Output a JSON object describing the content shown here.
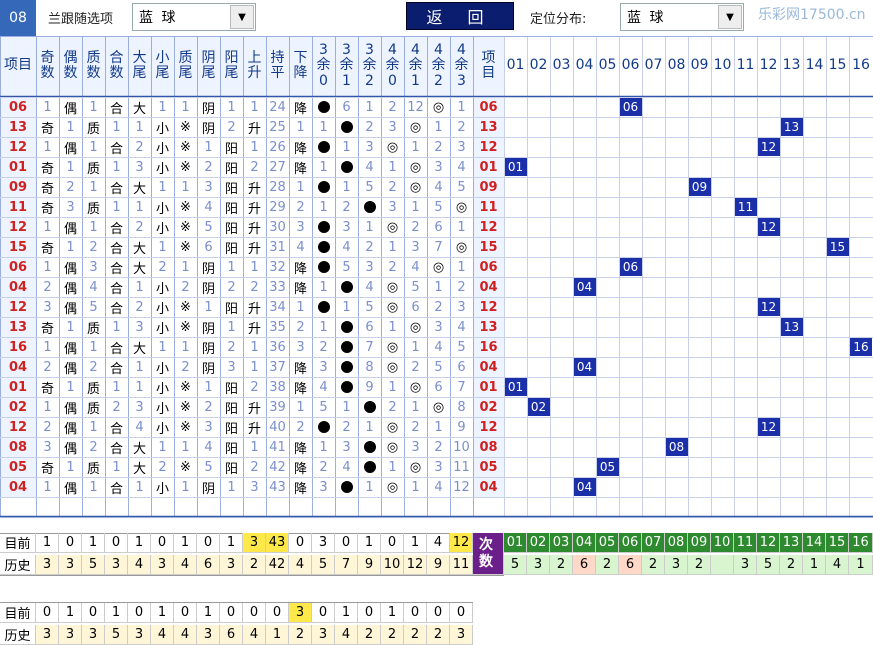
{
  "topbar": {
    "num": "08",
    "sel_label": "兰跟随选项",
    "combo1": "蓝 球",
    "back": "返 回",
    "dist_label": "定位分布:",
    "combo2": "蓝 球",
    "watermark": "乐彩网17500.cn"
  },
  "headers": [
    "项目",
    "奇数",
    "偶数",
    "质数",
    "合数",
    "大尾",
    "小尾",
    "质尾",
    "阴尾",
    "阳尾",
    "上升",
    "持平",
    "下降",
    "3余0",
    "3余1",
    "3余2",
    "4余0",
    "4余1",
    "4余2",
    "4余3",
    "项目"
  ],
  "cols": [
    "01",
    "02",
    "03",
    "04",
    "05",
    "06",
    "07",
    "08",
    "09",
    "10",
    "11",
    "12",
    "13",
    "14",
    "15",
    "16"
  ],
  "rows": [
    [
      "06",
      "1",
      "偶",
      "1",
      "合",
      "大",
      "1",
      "1",
      "阴",
      "1",
      "1",
      "24",
      "降",
      "●",
      "6",
      "1",
      "2",
      "12",
      "◎",
      "1",
      "06"
    ],
    [
      "13",
      "奇",
      "1",
      "质",
      "1",
      "1",
      "小",
      "※",
      "阴",
      "2",
      "升",
      "25",
      "1",
      "1",
      "●",
      "2",
      "3",
      "◎",
      "1",
      "2",
      "13"
    ],
    [
      "12",
      "1",
      "偶",
      "1",
      "合",
      "2",
      "小",
      "※",
      "1",
      "阳",
      "1",
      "26",
      "降",
      "●",
      "1",
      "3",
      "◎",
      "1",
      "2",
      "3",
      "12"
    ],
    [
      "01",
      "奇",
      "1",
      "质",
      "1",
      "3",
      "小",
      "※",
      "2",
      "阳",
      "2",
      "27",
      "降",
      "1",
      "●",
      "4",
      "1",
      "◎",
      "3",
      "4",
      "01"
    ],
    [
      "09",
      "奇",
      "2",
      "1",
      "合",
      "大",
      "1",
      "1",
      "3",
      "阳",
      "升",
      "28",
      "1",
      "●",
      "1",
      "5",
      "2",
      "◎",
      "4",
      "5",
      "09"
    ],
    [
      "11",
      "奇",
      "3",
      "质",
      "1",
      "1",
      "小",
      "※",
      "4",
      "阳",
      "升",
      "29",
      "2",
      "1",
      "2",
      "●",
      "3",
      "1",
      "5",
      "◎",
      "11"
    ],
    [
      "12",
      "1",
      "偶",
      "1",
      "合",
      "2",
      "小",
      "※",
      "5",
      "阳",
      "升",
      "30",
      "3",
      "●",
      "3",
      "1",
      "◎",
      "2",
      "6",
      "1",
      "12"
    ],
    [
      "15",
      "奇",
      "1",
      "2",
      "合",
      "大",
      "1",
      "※",
      "6",
      "阳",
      "升",
      "31",
      "4",
      "●",
      "4",
      "2",
      "1",
      "3",
      "7",
      "◎",
      "15"
    ],
    [
      "06",
      "1",
      "偶",
      "3",
      "合",
      "大",
      "2",
      "1",
      "阴",
      "1",
      "1",
      "32",
      "降",
      "●",
      "5",
      "3",
      "2",
      "4",
      "◎",
      "1",
      "06"
    ],
    [
      "04",
      "2",
      "偶",
      "4",
      "合",
      "1",
      "小",
      "2",
      "阴",
      "2",
      "2",
      "33",
      "降",
      "1",
      "●",
      "4",
      "◎",
      "5",
      "1",
      "2",
      "04"
    ],
    [
      "12",
      "3",
      "偶",
      "5",
      "合",
      "2",
      "小",
      "※",
      "1",
      "阳",
      "升",
      "34",
      "1",
      "●",
      "1",
      "5",
      "◎",
      "6",
      "2",
      "3",
      "12"
    ],
    [
      "13",
      "奇",
      "1",
      "质",
      "1",
      "3",
      "小",
      "※",
      "阴",
      "1",
      "升",
      "35",
      "2",
      "1",
      "●",
      "6",
      "1",
      "◎",
      "3",
      "4",
      "13"
    ],
    [
      "16",
      "1",
      "偶",
      "1",
      "合",
      "大",
      "1",
      "1",
      "阴",
      "2",
      "1",
      "36",
      "3",
      "2",
      "●",
      "7",
      "◎",
      "1",
      "4",
      "5",
      "16"
    ],
    [
      "04",
      "2",
      "偶",
      "2",
      "合",
      "1",
      "小",
      "2",
      "阴",
      "3",
      "1",
      "37",
      "降",
      "3",
      "●",
      "8",
      "◎",
      "2",
      "5",
      "6",
      "04"
    ],
    [
      "01",
      "奇",
      "1",
      "质",
      "1",
      "1",
      "小",
      "※",
      "1",
      "阳",
      "2",
      "38",
      "降",
      "4",
      "●",
      "9",
      "1",
      "◎",
      "6",
      "7",
      "01"
    ],
    [
      "02",
      "1",
      "偶",
      "质",
      "2",
      "3",
      "小",
      "※",
      "2",
      "阳",
      "升",
      "39",
      "1",
      "5",
      "1",
      "●",
      "2",
      "1",
      "◎",
      "8",
      "02"
    ],
    [
      "12",
      "2",
      "偶",
      "1",
      "合",
      "4",
      "小",
      "※",
      "3",
      "阳",
      "升",
      "40",
      "2",
      "●",
      "2",
      "1",
      "◎",
      "2",
      "1",
      "9",
      "12"
    ],
    [
      "08",
      "3",
      "偶",
      "2",
      "合",
      "大",
      "1",
      "1",
      "4",
      "阳",
      "1",
      "41",
      "降",
      "1",
      "3",
      "●",
      "◎",
      "3",
      "2",
      "10",
      "08"
    ],
    [
      "05",
      "奇",
      "1",
      "质",
      "1",
      "大",
      "2",
      "※",
      "5",
      "阳",
      "2",
      "42",
      "降",
      "2",
      "4",
      "●",
      "1",
      "◎",
      "3",
      "11",
      "05"
    ],
    [
      "04",
      "1",
      "偶",
      "1",
      "合",
      "1",
      "小",
      "1",
      "阴",
      "1",
      "3",
      "43",
      "降",
      "3",
      "●",
      "1",
      "◎",
      "1",
      "4",
      "12",
      "04"
    ]
  ],
  "stats": {
    "now_label": "目前",
    "hist_label": "历史",
    "count_label": "次数",
    "now": [
      "1",
      "0",
      "1",
      "0",
      "1",
      "0",
      "1",
      "0",
      "1",
      "3",
      "43",
      "0",
      "3",
      "0",
      "1",
      "0",
      "1",
      "4",
      "12"
    ],
    "hist": [
      "3",
      "3",
      "5",
      "3",
      "4",
      "3",
      "4",
      "6",
      "3",
      "2",
      "42",
      "4",
      "5",
      "7",
      "9",
      "10",
      "12",
      "9",
      "11"
    ],
    "pos_cols": [
      "01",
      "02",
      "03",
      "04",
      "05",
      "06",
      "07",
      "08",
      "09",
      "10",
      "11",
      "12",
      "13",
      "14",
      "15",
      "16"
    ],
    "pos_counts": [
      "5",
      "3",
      "2",
      "6",
      "2",
      "6",
      "2",
      "3",
      "2",
      "",
      "3",
      "5",
      "2",
      "1",
      "4",
      "1"
    ],
    "now2": [
      "0",
      "1",
      "0",
      "1",
      "0",
      "1",
      "0",
      "1",
      "0",
      "0",
      "0",
      "3",
      "0",
      "1",
      "0",
      "1",
      "0",
      "0",
      "0"
    ],
    "hist2": [
      "3",
      "3",
      "3",
      "5",
      "3",
      "4",
      "4",
      "3",
      "6",
      "4",
      "1",
      "2",
      "3",
      "4",
      "2",
      "2",
      "2",
      "2",
      "3"
    ]
  }
}
